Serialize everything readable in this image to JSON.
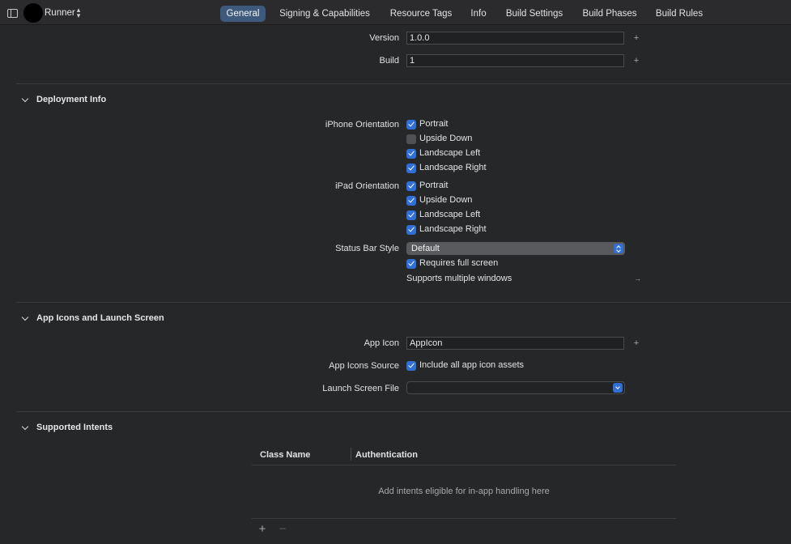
{
  "toolbar": {
    "target_name": "Runner",
    "tabs": [
      {
        "label": "General",
        "active": true
      },
      {
        "label": "Signing & Capabilities",
        "active": false
      },
      {
        "label": "Resource Tags",
        "active": false
      },
      {
        "label": "Info",
        "active": false
      },
      {
        "label": "Build Settings",
        "active": false
      },
      {
        "label": "Build Phases",
        "active": false
      },
      {
        "label": "Build Rules",
        "active": false
      }
    ]
  },
  "identity": {
    "version_label": "Version",
    "version_value": "1.0.0",
    "build_label": "Build",
    "build_value": "1"
  },
  "deployment_info": {
    "title": "Deployment Info",
    "iphone_orientation_label": "iPhone Orientation",
    "iphone_orientations": [
      {
        "label": "Portrait",
        "checked": true
      },
      {
        "label": "Upside Down",
        "checked": false
      },
      {
        "label": "Landscape Left",
        "checked": true
      },
      {
        "label": "Landscape Right",
        "checked": true
      }
    ],
    "ipad_orientation_label": "iPad Orientation",
    "ipad_orientations": [
      {
        "label": "Portrait",
        "checked": true
      },
      {
        "label": "Upside Down",
        "checked": true
      },
      {
        "label": "Landscape Left",
        "checked": true
      },
      {
        "label": "Landscape Right",
        "checked": true
      }
    ],
    "status_bar_style_label": "Status Bar Style",
    "status_bar_style_value": "Default",
    "requires_full_screen_label": "Requires full screen",
    "requires_full_screen_checked": true,
    "supports_multiple_windows_label": "Supports multiple windows"
  },
  "app_icons": {
    "title": "App Icons and Launch Screen",
    "app_icon_label": "App Icon",
    "app_icon_value": "AppIcon",
    "app_icons_source_label": "App Icons Source",
    "include_all_label": "Include all app icon assets",
    "include_all_checked": true,
    "launch_screen_label": "Launch Screen File",
    "launch_screen_value": ""
  },
  "supported_intents": {
    "title": "Supported Intents",
    "columns": [
      "Class Name",
      "Authentication"
    ],
    "empty_message": "Add intents eligible for in-app handling here",
    "add_label": "+",
    "remove_label": "−"
  },
  "icons": {
    "plus": "+",
    "arrow_right": "→",
    "chevron_updown": "⌃⌄"
  },
  "colors": {
    "accent": "#2f6fd6",
    "active_tab": "#3d5a7c",
    "background": "#262729"
  }
}
